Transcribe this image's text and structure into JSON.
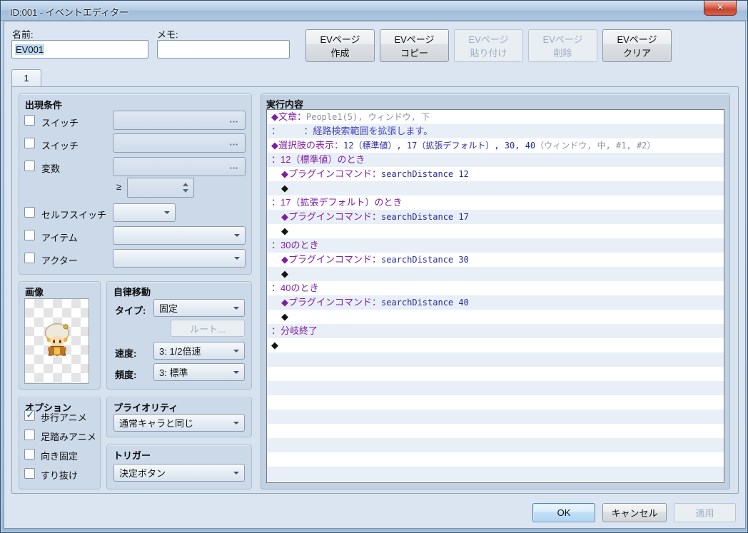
{
  "window": {
    "title": "ID:001 - イベントエディター",
    "close_glyph": "✕"
  },
  "ui": {
    "ellipsis": "…",
    "check_glyph": "✓"
  },
  "header": {
    "name_label": "名前:",
    "name_value": "EV001",
    "memo_label": "メモ:",
    "memo_value": "",
    "ev_buttons": [
      {
        "line1": "EVページ",
        "line2": "作成",
        "enabled": true
      },
      {
        "line1": "EVページ",
        "line2": "コピー",
        "enabled": true
      },
      {
        "line1": "EVページ",
        "line2": "貼り付け",
        "enabled": false
      },
      {
        "line1": "EVページ",
        "line2": "削除",
        "enabled": false
      },
      {
        "line1": "EVページ",
        "line2": "クリア",
        "enabled": true
      }
    ]
  },
  "tabs": [
    {
      "label": "1",
      "active": true
    }
  ],
  "conditions": {
    "title": "出現条件",
    "switch1": {
      "label": "スイッチ",
      "checked": false,
      "value": ""
    },
    "switch2": {
      "label": "スイッチ",
      "checked": false,
      "value": ""
    },
    "variable": {
      "label": "変数",
      "checked": false,
      "value": "",
      "operator": "≥",
      "threshold": ""
    },
    "self_switch": {
      "label": "セルフスイッチ",
      "checked": false,
      "value": ""
    },
    "item": {
      "label": "アイテム",
      "checked": false,
      "value": ""
    },
    "actor": {
      "label": "アクター",
      "checked": false,
      "value": ""
    }
  },
  "image_group": {
    "title": "画像",
    "sprite": "villager-girl-sprite"
  },
  "movement": {
    "title": "自律移動",
    "type_label": "タイプ:",
    "type_value": "固定",
    "route_button": "ルート...",
    "route_enabled": false,
    "speed_label": "速度:",
    "speed_value": "3: 1/2倍速",
    "freq_label": "頻度:",
    "freq_value": "3: 標準"
  },
  "options": {
    "title": "オプション",
    "items": [
      {
        "label": "歩行アニメ",
        "checked": true
      },
      {
        "label": "足踏みアニメ",
        "checked": false
      },
      {
        "label": "向き固定",
        "checked": false
      },
      {
        "label": "すり抜け",
        "checked": false
      }
    ]
  },
  "priority": {
    "title": "プライオリティ",
    "value": "通常キャラと同じ"
  },
  "trigger": {
    "title": "トリガー",
    "value": "決定ボタン"
  },
  "contents": {
    "title": "実行内容",
    "colors": {
      "command_purple": "#7E1FA2",
      "text_blue": "#4646BE",
      "param_navy": "#29299E",
      "param_gray": "#8C9097",
      "plain_black": "#141414",
      "stripe": "#E9EFF6"
    },
    "row_count": 26,
    "lines": [
      {
        "indent": 0,
        "segments": [
          {
            "t": "◆文章：",
            "c": "#7E1FA2"
          },
          {
            "t": "People1(5), ウィンドウ, 下",
            "c": "#8C9097",
            "m": 1
          }
        ]
      },
      {
        "indent": 0,
        "segments": [
          {
            "t": "：　　　：経路検索範囲を拡張します。",
            "c": "#4646BE"
          }
        ]
      },
      {
        "indent": 0,
        "segments": [
          {
            "t": "◆選択肢の表示：",
            "c": "#7E1FA2"
          },
          {
            "t": "12（標準値）, 17（拡張デフォルト）, 30, 40",
            "c": "#29299E",
            "m": 1
          },
          {
            "t": "（ウィンドウ, 中, #1, #2）",
            "c": "#8C9097",
            "m": 1
          }
        ]
      },
      {
        "indent": 0,
        "segments": [
          {
            "t": "：12（標準値）のとき",
            "c": "#7E1FA2"
          }
        ]
      },
      {
        "indent": 1,
        "segments": [
          {
            "t": "◆プラグインコマンド：",
            "c": "#7E1FA2"
          },
          {
            "t": "searchDistance 12",
            "c": "#29299E",
            "m": 1
          }
        ]
      },
      {
        "indent": 1,
        "segments": [
          {
            "t": "◆",
            "c": "#141414"
          }
        ]
      },
      {
        "indent": 0,
        "segments": [
          {
            "t": "：17（拡張デフォルト）のとき",
            "c": "#7E1FA2"
          }
        ]
      },
      {
        "indent": 1,
        "segments": [
          {
            "t": "◆プラグインコマンド：",
            "c": "#7E1FA2"
          },
          {
            "t": "searchDistance 17",
            "c": "#29299E",
            "m": 1
          }
        ]
      },
      {
        "indent": 1,
        "segments": [
          {
            "t": "◆",
            "c": "#141414"
          }
        ]
      },
      {
        "indent": 0,
        "segments": [
          {
            "t": "：30のとき",
            "c": "#7E1FA2"
          }
        ]
      },
      {
        "indent": 1,
        "segments": [
          {
            "t": "◆プラグインコマンド：",
            "c": "#7E1FA2"
          },
          {
            "t": "searchDistance 30",
            "c": "#29299E",
            "m": 1
          }
        ]
      },
      {
        "indent": 1,
        "segments": [
          {
            "t": "◆",
            "c": "#141414"
          }
        ]
      },
      {
        "indent": 0,
        "segments": [
          {
            "t": "：40のとき",
            "c": "#7E1FA2"
          }
        ]
      },
      {
        "indent": 1,
        "segments": [
          {
            "t": "◆プラグインコマンド：",
            "c": "#7E1FA2"
          },
          {
            "t": "searchDistance 40",
            "c": "#29299E",
            "m": 1
          }
        ]
      },
      {
        "indent": 1,
        "segments": [
          {
            "t": "◆",
            "c": "#141414"
          }
        ]
      },
      {
        "indent": 0,
        "segments": [
          {
            "t": "：分岐終了",
            "c": "#7E1FA2"
          }
        ]
      },
      {
        "indent": 0,
        "segments": [
          {
            "t": "◆",
            "c": "#141414"
          }
        ]
      }
    ]
  },
  "footer": {
    "buttons": [
      {
        "label": "OK",
        "enabled": true,
        "focused": true
      },
      {
        "label": "キャンセル",
        "enabled": true,
        "focused": false
      },
      {
        "label": "適用",
        "enabled": false,
        "focused": false
      }
    ]
  }
}
